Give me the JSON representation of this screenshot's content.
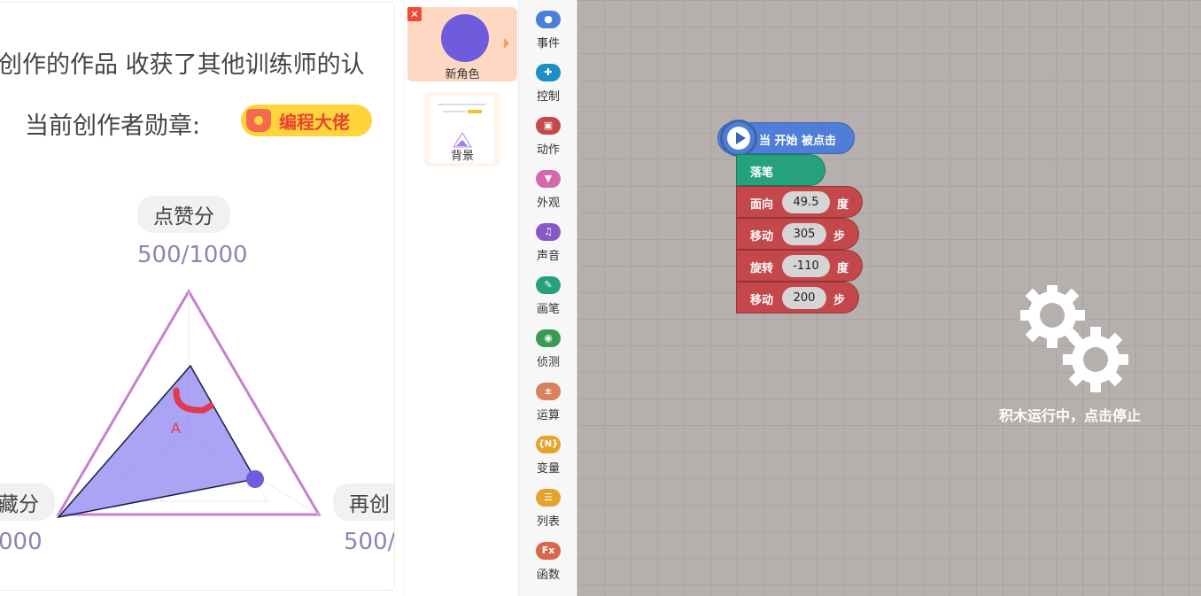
{
  "stage": {
    "line1": "创作的作品 收获了其他训练师的认",
    "line2": "当前创作者勋章:",
    "badge": "编程大佬",
    "axis_top": "点赞分",
    "score_top": "500/1000",
    "axis_left": "藏分",
    "score_left": "000",
    "axis_right": "再创",
    "score_right": "500/",
    "radar_letter": "A"
  },
  "sprites": {
    "delete_icon": "✕",
    "sprite_name": "新角色",
    "background_name": "背景"
  },
  "categories": [
    {
      "label": "事件",
      "color": "#4a80d8",
      "icon": "toggle-icon",
      "glyph": "●"
    },
    {
      "label": "控制",
      "color": "#1c8fc7",
      "icon": "gamepad-icon",
      "glyph": "✚"
    },
    {
      "label": "动作",
      "color": "#c44a4a",
      "icon": "motion-icon",
      "glyph": "▣"
    },
    {
      "label": "外观",
      "color": "#d667a8",
      "icon": "shirt-icon",
      "glyph": "▼"
    },
    {
      "label": "声音",
      "color": "#8a57c9",
      "icon": "music-icon",
      "glyph": "♫"
    },
    {
      "label": "画笔",
      "color": "#26a17e",
      "icon": "pen-icon",
      "glyph": "✎"
    },
    {
      "label": "侦测",
      "color": "#3a9a52",
      "icon": "sensor-icon",
      "glyph": "◉"
    },
    {
      "label": "运算",
      "color": "#d9805e",
      "icon": "math-icon",
      "glyph": "±"
    },
    {
      "label": "变量",
      "color": "#e3a32c",
      "icon": "variable-icon",
      "glyph": "{N}"
    },
    {
      "label": "列表",
      "color": "#e3a32c",
      "icon": "list-icon",
      "glyph": "☰"
    },
    {
      "label": "函数",
      "color": "#d9674a",
      "icon": "function-icon",
      "glyph": "Fx"
    }
  ],
  "workspace": {
    "hat_label": "当 开始 被点击",
    "blocks": {
      "pen_down": "落笔",
      "face": {
        "label": "面向",
        "value": "49.5",
        "unit": "度"
      },
      "move1": {
        "label": "移动",
        "value": "305",
        "unit": "步"
      },
      "turn": {
        "label": "旋转",
        "value": "-110",
        "unit": "度"
      },
      "move2": {
        "label": "移动",
        "value": "200",
        "unit": "步"
      }
    },
    "running_label": "积木运行中，点击停止"
  }
}
